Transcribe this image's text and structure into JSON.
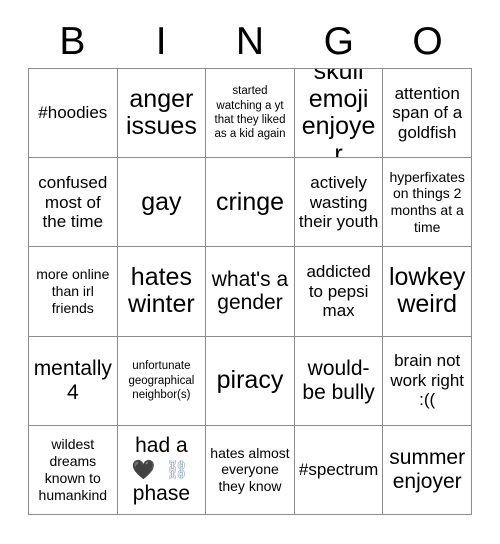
{
  "card": {
    "title_letters": [
      "B",
      "I",
      "N",
      "G",
      "O"
    ],
    "background_color": "#ffffff",
    "border_color": "#8c8c8c",
    "text_color": "#000000",
    "columns": 5,
    "rows": 5,
    "cells": [
      {
        "text": "#hoodies",
        "size": "s-md"
      },
      {
        "text": "anger issues",
        "size": "s-xl"
      },
      {
        "text": "started watching a yt that they liked as a kid again",
        "size": "s-xs"
      },
      {
        "text": "skull emoji enjoyer",
        "size": "s-xl"
      },
      {
        "text": "attention span of a goldfish",
        "size": "s-md"
      },
      {
        "text": "confused most of the time",
        "size": "s-md"
      },
      {
        "text": "gay",
        "size": "s-xl"
      },
      {
        "text": "cringe",
        "size": "s-xl"
      },
      {
        "text": "actively wasting their youth",
        "size": "s-md"
      },
      {
        "text": "hyperfixates on things 2 months at a time",
        "size": "s-sm"
      },
      {
        "text": "more online than irl friends",
        "size": "s-sm"
      },
      {
        "text": "hates winter",
        "size": "s-xl"
      },
      {
        "text": "what's a gender",
        "size": "s-lg"
      },
      {
        "text": "addicted to pepsi max",
        "size": "s-md"
      },
      {
        "text": "lowkey weird",
        "size": "s-xl"
      },
      {
        "text": "mentally 4",
        "size": "s-lg"
      },
      {
        "text": "unfortunate geographical neighbor(s)",
        "size": "s-xs"
      },
      {
        "text": "piracy",
        "size": "s-xl"
      },
      {
        "text": "would-be bully",
        "size": "s-lg"
      },
      {
        "text": "brain not work right :((",
        "size": "s-md"
      },
      {
        "text": "wildest dreams known to humankind",
        "size": "s-sm"
      },
      {
        "text": "had a 🖤 ⛓ phase",
        "size": "s-lg",
        "emoji_cell": true,
        "line1": "had a",
        "emoji_heart": "🖤",
        "emoji_chains": "⛓",
        "line3": "phase"
      },
      {
        "text": "hates almost everyone they know",
        "size": "s-sm"
      },
      {
        "text": "#spectrum",
        "size": "s-md"
      },
      {
        "text": "summer enjoyer",
        "size": "s-lg"
      }
    ]
  }
}
